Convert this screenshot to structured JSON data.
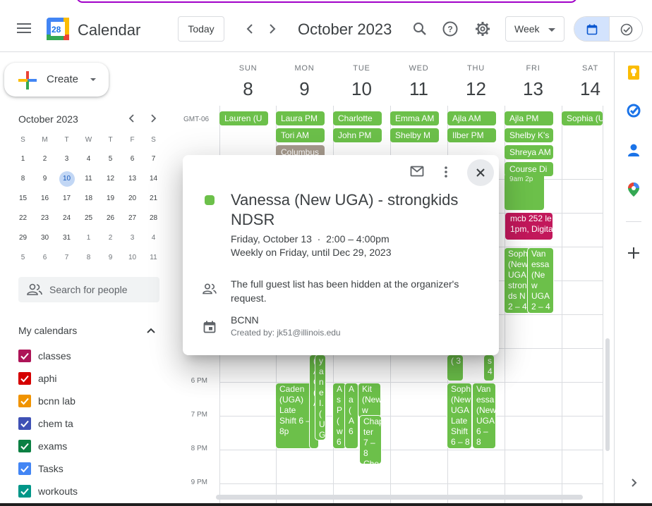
{
  "header": {
    "app_title": "Calendar",
    "logo_day": "28",
    "today_label": "Today",
    "month_title": "October 2023",
    "view_label": "Week"
  },
  "sidebar": {
    "create_label": "Create",
    "mini_calendar": {
      "title": "October 2023",
      "weekdays": [
        "S",
        "M",
        "T",
        "W",
        "T",
        "F",
        "S"
      ],
      "weeks": [
        [
          "1",
          "2",
          "3",
          "4",
          "5",
          "6",
          "7"
        ],
        [
          "8",
          "9",
          "10",
          "11",
          "12",
          "13",
          "14"
        ],
        [
          "15",
          "16",
          "17",
          "18",
          "19",
          "20",
          "21"
        ],
        [
          "22",
          "23",
          "24",
          "25",
          "26",
          "27",
          "28"
        ],
        [
          "29",
          "30",
          "31",
          "1",
          "2",
          "3",
          "4"
        ],
        [
          "5",
          "6",
          "7",
          "8",
          "9",
          "10",
          "11"
        ]
      ],
      "today": "10"
    },
    "people_search_placeholder": "Search for people",
    "my_calendars_title": "My calendars",
    "calendars": [
      {
        "name": "classes",
        "color": "#ad1457"
      },
      {
        "name": "aphi",
        "color": "#d50000"
      },
      {
        "name": "bcnn lab",
        "color": "#f09300"
      },
      {
        "name": "chem ta",
        "color": "#3f51b5"
      },
      {
        "name": "exams",
        "color": "#0b8043"
      },
      {
        "name": "Tasks",
        "color": "#4285f4"
      },
      {
        "name": "workouts",
        "color": "#009688"
      }
    ]
  },
  "grid": {
    "timezone": "GMT-06",
    "days": [
      {
        "name": "SUN",
        "num": "8"
      },
      {
        "name": "MON",
        "num": "9"
      },
      {
        "name": "TUE",
        "num": "10"
      },
      {
        "name": "WED",
        "num": "11"
      },
      {
        "name": "THU",
        "num": "12"
      },
      {
        "name": "FRI",
        "num": "13"
      },
      {
        "name": "SAT",
        "num": "14"
      }
    ],
    "time_labels": [
      "6 PM",
      "7 PM",
      "8 PM",
      "9 PM"
    ],
    "allday_events": {
      "sun": [
        "Lauren (U"
      ],
      "mon": [
        "Laura PM",
        "Tori AM",
        "Columbus"
      ],
      "tue": [
        "Charlotte",
        "John PM"
      ],
      "wed": [
        "Emma AM",
        "Shelby M"
      ],
      "thu": [
        "Ajla AM",
        "Ilber PM"
      ],
      "fri": [
        "Ajla PM",
        "Shelby K's",
        "Shreya AM",
        "Course Di"
      ],
      "sat": [
        "Sophia (U"
      ]
    },
    "fri_events": {
      "top_fragment": "9am    2p",
      "mcb_title": "mcb 252 le",
      "mcb_time": "1pm, Digita",
      "sophia": "Soph (New UGA stron ds N 2 – 4",
      "vanessa": "Van essa (Ne w UGA 2 – 4"
    },
    "evening_events": {
      "mon_caden": "Caden (UGA) Late Shift 6 – 8p",
      "mon_frag1": "( A G ( A",
      "mon_frag2": "y a n e I. ( U G 4",
      "tue_frag1": "A s P ( w 6",
      "tue_frag2": "A a ( A 6",
      "tue_kit": "Kit (New w",
      "tue_chap": "Chap ter 7 – 8 Che",
      "thu_frag": "( 3",
      "thu_frag2": "s 4",
      "thu_sophia": "Soph (New UGA Late Shift 6 – 8",
      "thu_vanessa": "Van essa (New UGA 6 – 8"
    }
  },
  "popup": {
    "title": "Vanessa (New UGA) - strongkids NDSR",
    "when": "Friday, October 13  ·  2:00 – 4:00pm",
    "recurrence": "Weekly on Friday, until Dec 29, 2023",
    "guests": "The full guest list has been hidden at the organizer's request.",
    "calendar": "BCNN",
    "creator": "Created by: jk51@illinois.edu"
  },
  "colors": {
    "event_green": "#6cc04a",
    "event_brown": "#a79b8e",
    "event_magenta": "#c2185b",
    "today_highlight": "#c2d7f5",
    "accent_blue": "#1a73e8"
  }
}
